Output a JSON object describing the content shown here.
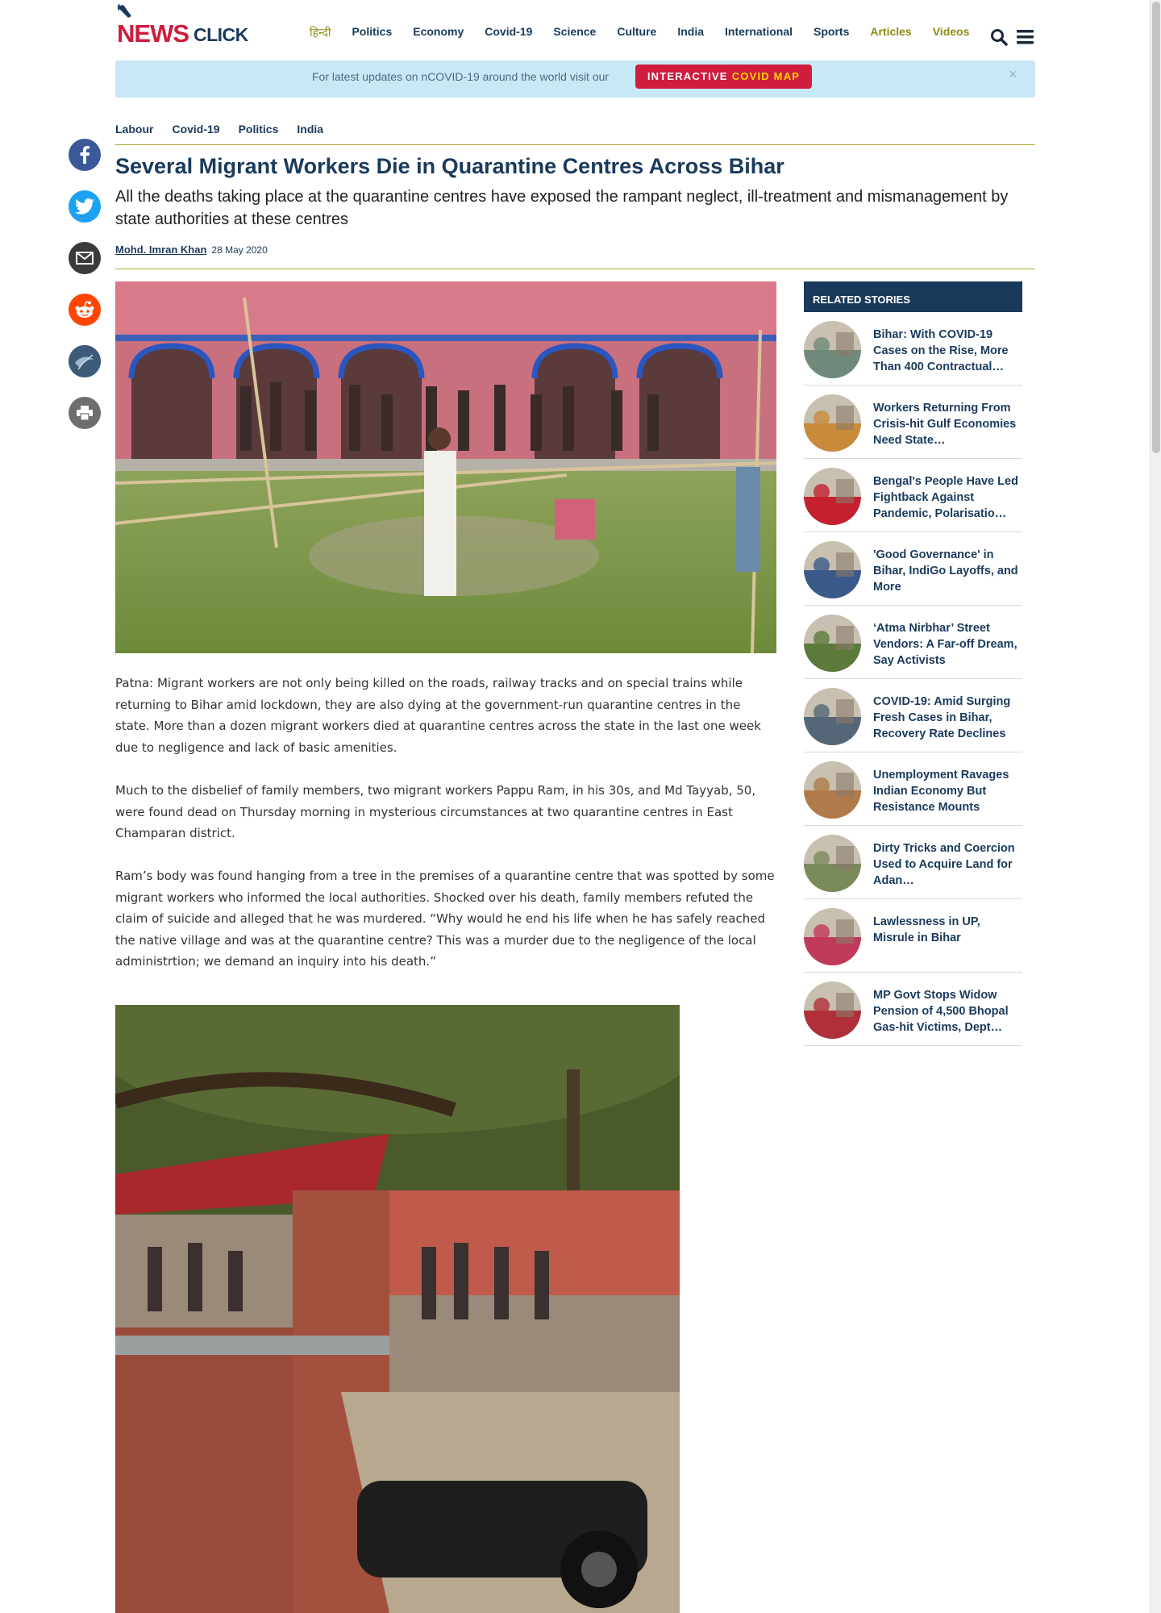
{
  "site": {
    "logo_news": "NEWS",
    "logo_click": "CLICK",
    "nav": [
      "हिन्दी",
      "Politics",
      "Economy",
      "Covid-19",
      "Science",
      "Culture",
      "India",
      "International",
      "Sports",
      "Articles",
      "Videos"
    ]
  },
  "banner": {
    "text": "For latest updates on nCOVID-19 around the world visit our",
    "button_main": "INTERACTIVE",
    "button_accent": "COVID MAP",
    "close": "×"
  },
  "share": [
    "facebook-icon",
    "twitter-icon",
    "email-icon",
    "reddit-icon",
    "telegram-icon",
    "print-icon"
  ],
  "article": {
    "tags": [
      "Labour",
      "Covid-19",
      "Politics",
      "India"
    ],
    "title": "Several Migrant Workers Die in Quarantine Centres Across Bihar",
    "subtitle": "All the deaths taking place at the quarantine centres have exposed the rampant neglect, ill-treatment and mismanagement by state authorities at these centres",
    "author": "Mohd. Imran Khan",
    "date": "28 May 2020",
    "paragraphs": [
      "Patna: Migrant workers are not only being killed on the roads, railway tracks and on special trains while returning to Bihar amid lockdown, they are also dying at the government-run quarantine centres in the state. More than a dozen migrant workers died at quarantine centres across the state in the last one week due to negligence and lack of basic amenities.",
      "Much to the disbelief of family members, two migrant workers Pappu Ram, in his 30s, and Md Tayyab, 50, were found dead on Thursday morning in mysterious circumstances at two quarantine centres in East Champaran district.",
      "Ram’s body was found hanging from a tree in the premises of a quarantine centre that was spotted by some migrant workers who informed the local authorities. Shocked over his death, family members refuted the claim of suicide and alleged that he was murdered. “Why would he end his life when he has safely reached the native village and was at the quarantine centre? This was a murder due to the negligence of the local administrtion; we demand an inquiry into his death.”"
    ]
  },
  "sidebar": {
    "heading": "RELATED STORIES",
    "stories": [
      {
        "title": "Bihar: With COVID-19 Cases on the Rise, More Than 400 Contractual…",
        "color": "#6f8a7a"
      },
      {
        "title": "Workers Returning From Crisis-hit Gulf Economies Need State…",
        "color": "#c98a3a"
      },
      {
        "title": "Bengal's People Have Led Fightback Against Pandemic, Polarisatio…",
        "color": "#c4212f"
      },
      {
        "title": "'Good Governance' in Bihar, IndiGo Layoffs, and More",
        "color": "#3b5a8a"
      },
      {
        "title": "‘Atma Nirbhar’ Street Vendors: A Far-off Dream, Say Activists",
        "color": "#5c7a3a"
      },
      {
        "title": "COVID-19: Amid Surging Fresh Cases in Bihar, Recovery Rate Declines",
        "color": "#556677"
      },
      {
        "title": "Unemployment Ravages Indian Economy But Resistance Mounts",
        "color": "#b07a4a"
      },
      {
        "title": "Dirty Tricks and Coercion Used to Acquire Land for Adan…",
        "color": "#7a8a5a"
      },
      {
        "title": "Lawlessness in UP, Misrule in Bihar",
        "color": "#c03a5a"
      },
      {
        "title": "MP Govt Stops Widow Pension of 4,500 Bhopal Gas-hit Victims, Dept…",
        "color": "#b0303a"
      }
    ]
  },
  "colors": {
    "brand_red": "#d01c3d",
    "navy": "#1a3a5c",
    "olive": "#8f8a12",
    "banner_bg": "#c8e8f5"
  }
}
